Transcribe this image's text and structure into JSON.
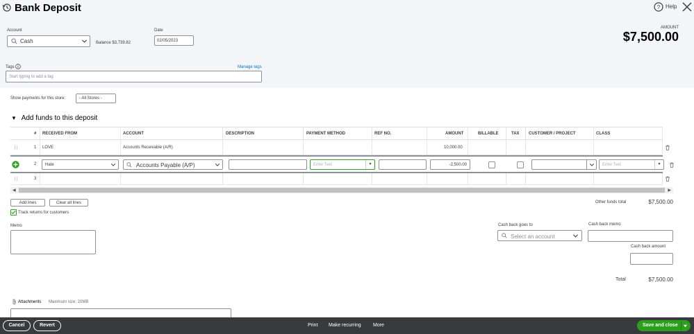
{
  "header": {
    "title": "Bank Deposit",
    "help_label": "Help",
    "account_label": "Account",
    "account_value": "Cash",
    "balance_text": "Balance $3,739.82",
    "date_label": "Date",
    "date_value": "02/05/2023",
    "amount_label": "AMOUNT",
    "amount_value": "$7,500.00",
    "tags_label": "Tags",
    "manage_tags": "Manage tags",
    "tags_placeholder": "Start typing to add a tag"
  },
  "store": {
    "label": "Show payments for this store:",
    "value": "- All Stores -"
  },
  "section_title": "Add funds to this deposit",
  "grid": {
    "columns": [
      "#",
      "RECEIVED FROM",
      "ACCOUNT",
      "DESCRIPTION",
      "PAYMENT METHOD",
      "REF NO.",
      "AMOUNT",
      "BILLABLE",
      "TAX",
      "CUSTOMER / PROJECT",
      "CLASS"
    ],
    "rows": [
      {
        "num": "1",
        "received_from": "LOVE",
        "account": "Accounts Receivable (A/R)",
        "amount": "10,000.00"
      },
      {
        "num": "2",
        "received_from": "Hate",
        "account": "Accounts Payable (A/P)",
        "payment_placeholder": "Enter Text",
        "amount": "-2,500.00",
        "class_placeholder": "Enter Text"
      },
      {
        "num": "3"
      }
    ]
  },
  "actions": {
    "add_lines": "Add lines",
    "clear_all_lines": "Clear all lines",
    "track_returns": "Track returns for customers",
    "track_checked": true
  },
  "other_funds": {
    "label": "Other funds total",
    "value": "$7,500.00"
  },
  "memo_label": "Memo",
  "cash_back": {
    "goes_to_label": "Cash back goes to",
    "goes_to_placeholder": "Select an account",
    "memo_label": "Cash back memo",
    "amount_label": "Cash back amount"
  },
  "total": {
    "label": "Total",
    "value": "$7,500.00"
  },
  "attachments": {
    "label": "Attachments",
    "max_size": "Maximum size: 20MB"
  },
  "footer": {
    "cancel": "Cancel",
    "revert": "Revert",
    "print": "Print",
    "make_recurring": "Make recurring",
    "more": "More",
    "save_and_close": "Save and close"
  },
  "colors": {
    "accent_green": "#2ca01c",
    "footer_bg": "#393a3d",
    "link_blue": "#0077c5"
  }
}
